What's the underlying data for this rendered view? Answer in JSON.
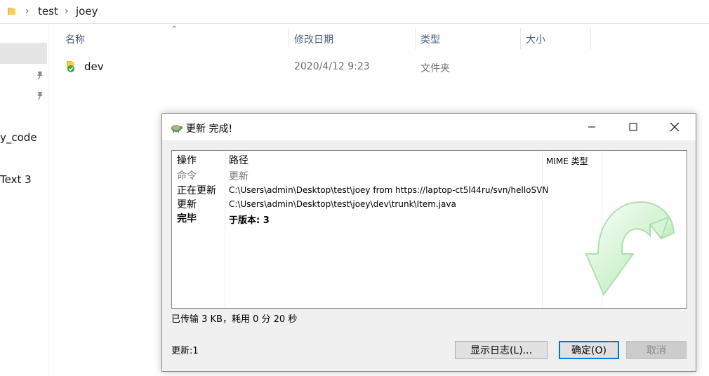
{
  "explorer": {
    "breadcrumb": [
      "test",
      "joey"
    ],
    "left_pane": {
      "labels": [
        "y_code",
        "Text 3"
      ]
    },
    "columns": {
      "name": "名称",
      "date": "修改日期",
      "type": "类型",
      "size": "大小"
    },
    "rows": [
      {
        "name": "dev",
        "date": "2020/4/12 9:23",
        "type": "文件夹",
        "size": ""
      }
    ]
  },
  "dialog": {
    "title": "更新 完成!",
    "list": {
      "headers": {
        "action": "操作",
        "path": "路径",
        "mime": "MIME 类型"
      },
      "rows": [
        {
          "action": "命令",
          "path": "更新",
          "style": "grey"
        },
        {
          "action": "正在更新",
          "path": "C:\\Users\\admin\\Desktop\\test\\joey from https://laptop-ct5l44ru/svn/helloSVN",
          "style": "normal"
        },
        {
          "action": "更新",
          "path": "C:\\Users\\admin\\Desktop\\test\\joey\\dev\\trunk\\Item.java",
          "style": "normal"
        },
        {
          "action": "完毕",
          "path": "于版本: 3",
          "style": "bold"
        }
      ]
    },
    "transfer_stats": "已传输 3 KB，耗用 0 分 20 秒",
    "update_count": "更新:1",
    "buttons": {
      "show_log": "显示日志(L)...",
      "ok": "确定(O)",
      "cancel": "取消"
    }
  },
  "colors": {
    "accent": "#0078d7",
    "header_text": "#4c607a",
    "arrow_green": "#9be39b"
  }
}
